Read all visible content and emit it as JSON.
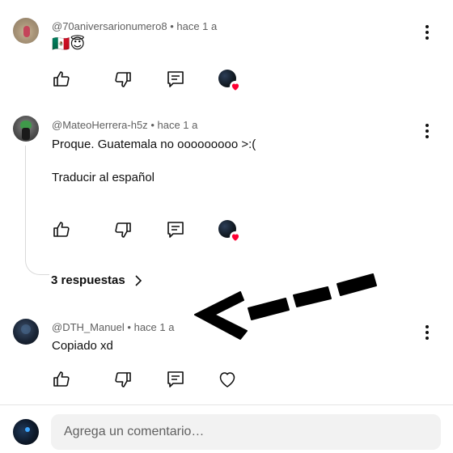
{
  "comments": [
    {
      "author": "@70aniversarionumero8",
      "time": "hace 1 a",
      "text": "🇲🇽😇"
    },
    {
      "author": "@MateoHerrera-h5z",
      "time": "hace 1 a",
      "text": "Proque. Guatemala no ooooooooo >:(",
      "translate": "Traducir al español",
      "replies_label": "3 respuestas"
    },
    {
      "author": "@DTH_Manuel",
      "time": "hace 1 a",
      "text": "Copiado xd"
    }
  ],
  "meta_separator": "•",
  "icons": {
    "like": "thumbs-up-icon",
    "dislike": "thumbs-down-icon",
    "reply": "reply-icon",
    "more": "more-vert-icon",
    "heart": "heart-icon",
    "chevron": "chevron-right-icon",
    "annotation": "arrow-annotation"
  },
  "composer": {
    "placeholder": "Agrega un comentario…"
  },
  "colors": {
    "heart": "#ff0033",
    "meta_text": "#606060",
    "input_bg": "#f2f2f2"
  }
}
